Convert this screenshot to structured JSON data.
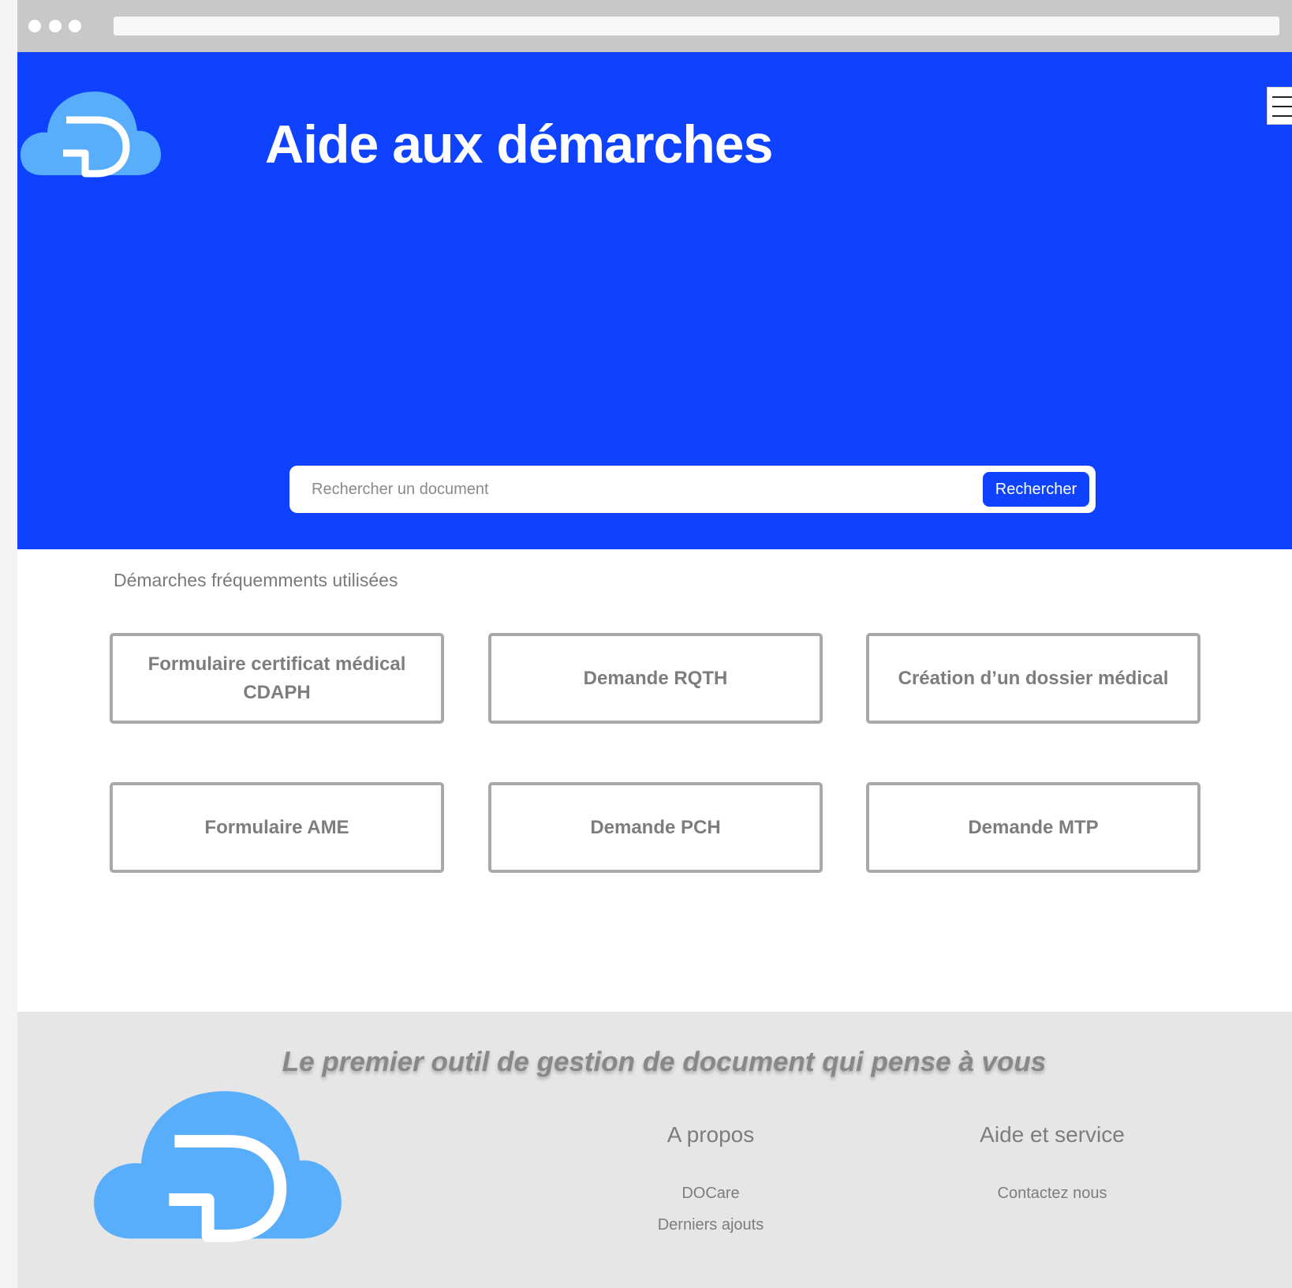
{
  "hero": {
    "title": "Aide aux démarches"
  },
  "search": {
    "placeholder": "Rechercher un document",
    "button_label": "Rechercher"
  },
  "frequent": {
    "title": "Démarches fréquemments utilisées",
    "cards": [
      "Formulaire certificat médical CDAPH",
      "Demande RQTH",
      "Création d’un dossier médical",
      "Formulaire AME",
      "Demande PCH",
      "Demande MTP"
    ]
  },
  "footer": {
    "tagline": "Le  premier outil de gestion de document qui pense à vous",
    "about": {
      "heading": "A propos",
      "links": [
        "DOCare",
        "Derniers ajouts"
      ]
    },
    "help": {
      "heading": "Aide et service",
      "links": [
        "Contactez nous"
      ]
    }
  },
  "colors": {
    "brand_blue": "#0e42ff",
    "logo_blue": "#59aefc",
    "footer_bg": "#e6e6e6",
    "card_border": "#a9a9a9"
  },
  "icons": {
    "logo": "cloud-d-logo-icon",
    "menu": "hamburger-menu-icon"
  }
}
